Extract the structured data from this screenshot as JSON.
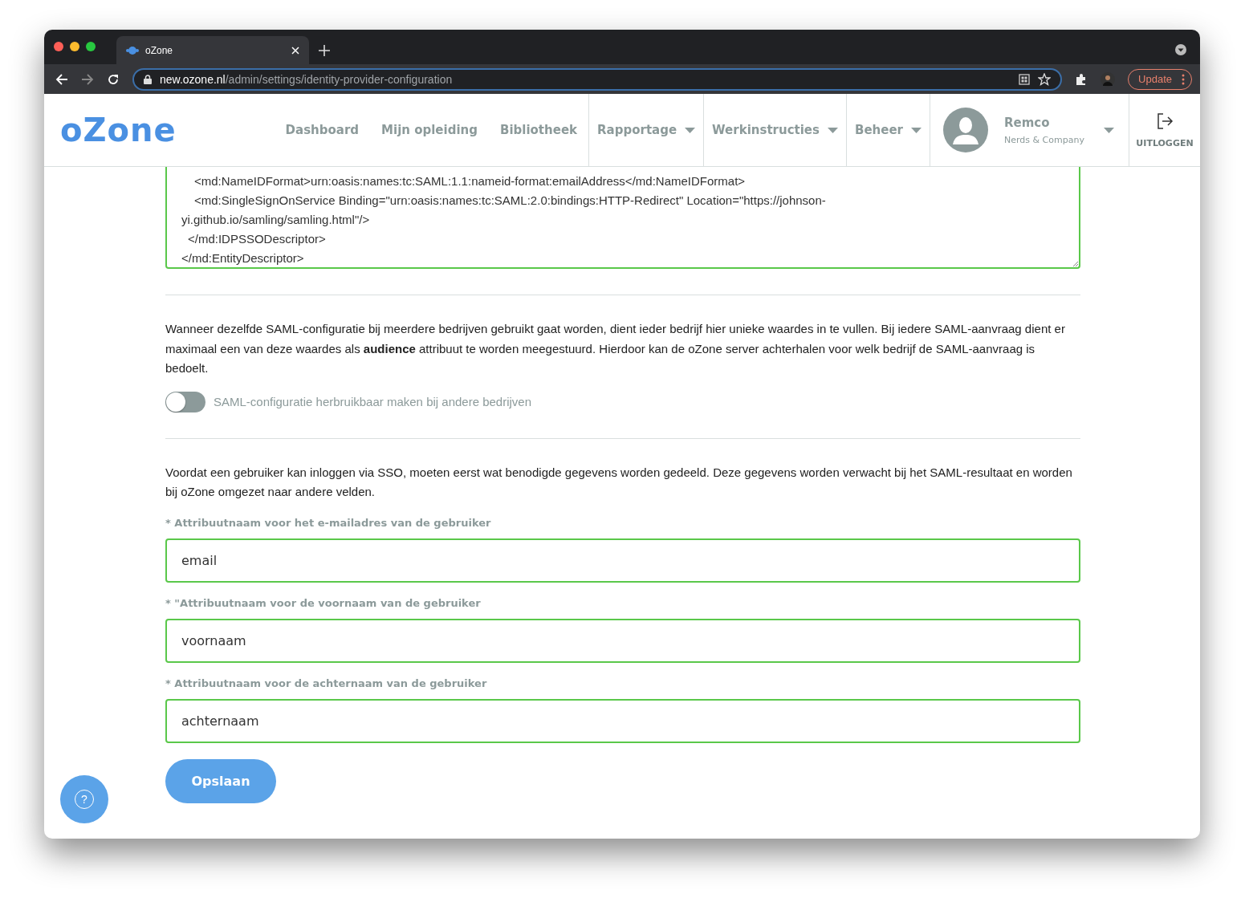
{
  "browser": {
    "tab_title": "oZone",
    "url_host": "new.ozone.nl",
    "url_path": "/admin/settings/identity-provider-configuration",
    "update_label": "Update"
  },
  "header": {
    "logo": "oZone",
    "nav": [
      {
        "label": "Dashboard",
        "dropdown": false
      },
      {
        "label": "Mijn opleiding",
        "dropdown": false
      },
      {
        "label": "Bibliotheek",
        "dropdown": false
      },
      {
        "label": "Rapportage",
        "dropdown": true
      },
      {
        "label": "Werkinstructies",
        "dropdown": true
      },
      {
        "label": "Beheer",
        "dropdown": true
      }
    ],
    "user": {
      "name": "Remco",
      "company": "Nerds & Company"
    },
    "logout": "UITLOGGEN"
  },
  "metadata_lines": [
    "<md:NameIDFormat>urn:oasis:names:tc:SAML:1.1:nameid-format:emailAddress</md:NameIDFormat>",
    "<md:SingleSignOnService Binding=\"urn:oasis:names:tc:SAML:2.0:bindings:HTTP-Redirect\" Location=\"https://johnson-",
    "yi.github.io/samling/samling.html\"/>",
    "</md:IDPSSODescriptor>",
    "</md:EntityDescriptor>"
  ],
  "audience_text": "Wanneer dezelfde SAML-configuratie bij meerdere bedrijven gebruikt gaat worden, dient ieder bedrijf hier unieke waardes in te vullen. Bij iedere SAML-aanvraag dient er maximaal een van deze waardes als **audience** attribuut te worden meegestuurd. Hierdoor kan de oZone server achterhalen voor welk bedrijf de SAML-aanvraag is bedoelt.",
  "reuse_toggle": {
    "label": "SAML-configuratie herbruikbaar maken bij andere bedrijven",
    "on": false
  },
  "attributes_text": "Voordat een gebruiker kan inloggen via SSO, moeten eerst wat benodigde gegevens worden gedeeld. Deze gegevens worden verwacht bij het SAML-resultaat en worden bij oZone omgezet naar andere velden.",
  "fields": [
    {
      "label": "* Attribuutnaam voor het e-mailadres van de gebruiker",
      "value": "email"
    },
    {
      "label": "* \"Attribuutnaam voor de voornaam van de gebruiker",
      "value": "voornaam"
    },
    {
      "label": "* Attribuutnaam voor de achternaam van de gebruiker",
      "value": "achternaam"
    }
  ],
  "save_button": "Opslaan",
  "help_button": "?"
}
